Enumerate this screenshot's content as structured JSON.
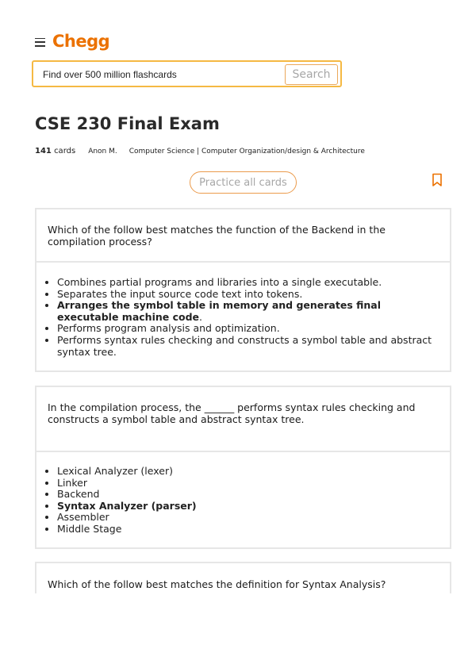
{
  "header": {
    "logo": "Chegg",
    "menu_icon": "hamburger-menu-icon"
  },
  "search": {
    "placeholder": "Find over 500 million flashcards",
    "button": "Search"
  },
  "deck": {
    "title": "CSE 230 Final Exam",
    "card_count": "141",
    "card_count_label": "cards",
    "author": "Anon M.",
    "category": "Computer Science | Computer Organization/design & Architecture"
  },
  "actions": {
    "practice_label": "Practice all cards",
    "bookmark_icon": "bookmark-icon"
  },
  "accent_color": "#eb7100",
  "cards": [
    {
      "question": "Which of the follow best matches the function of the Backend in the compilation process?",
      "answers": [
        {
          "text": "Combines partial programs and libraries into a single executable.",
          "correct": false
        },
        {
          "text": "Separates the input source code text into tokens.",
          "correct": false
        },
        {
          "text": "Arranges the symbol table in memory and generates final executable machine code",
          "correct": true
        },
        {
          "text": "Performs program analysis and optimization.",
          "correct": false
        },
        {
          "text": "Performs syntax rules checking and constructs a symbol table and abstract syntax tree.",
          "correct": false
        }
      ]
    },
    {
      "question": "In the compilation process, the ______ performs syntax rules checking and constructs a symbol table and abstract syntax tree.",
      "answers": [
        {
          "text": "Lexical Analyzer (lexer)",
          "correct": false
        },
        {
          "text": "Linker",
          "correct": false
        },
        {
          "text": "Backend",
          "correct": false
        },
        {
          "text": "Syntax Analyzer (parser)",
          "correct": true
        },
        {
          "text": "Assembler",
          "correct": false
        },
        {
          "text": "Middle Stage",
          "correct": false
        }
      ]
    },
    {
      "question": "Which of the follow best matches the definition for Syntax Analysis?"
    }
  ]
}
